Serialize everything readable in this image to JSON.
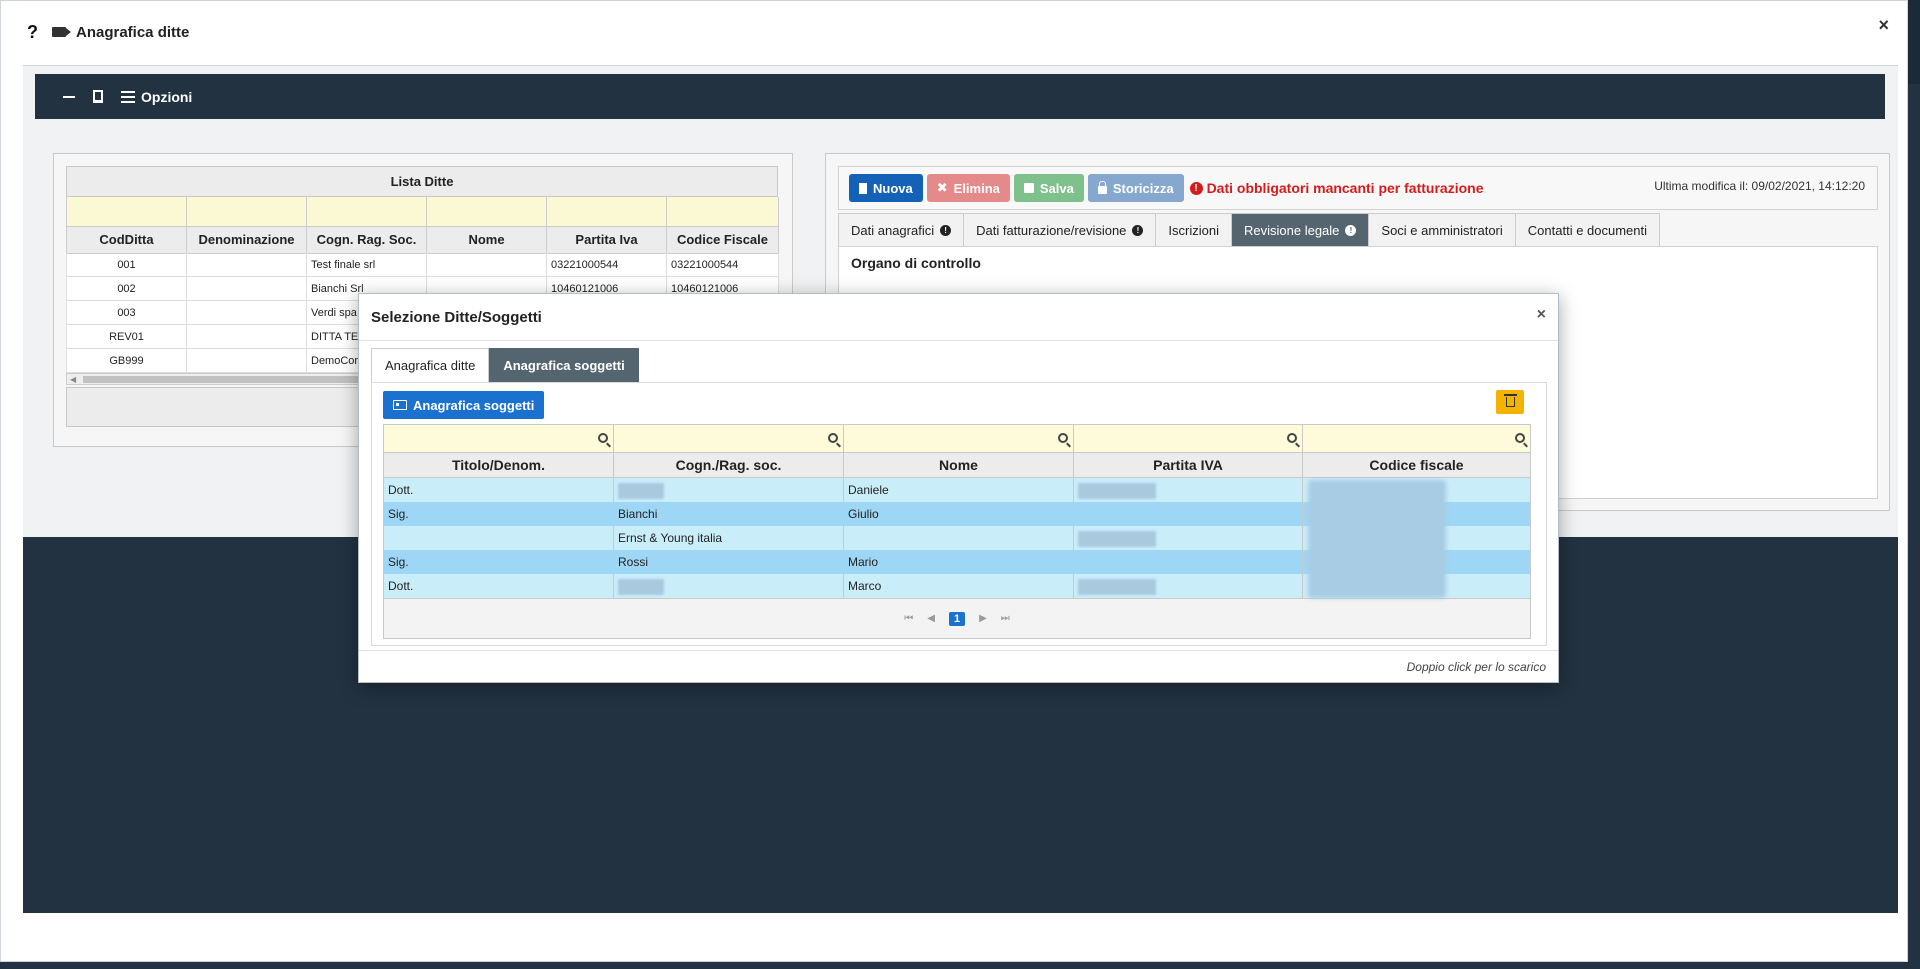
{
  "window": {
    "help_label": "?",
    "title": "Anagrafica ditte",
    "close_label": "×"
  },
  "toolbar": {
    "options_label": "Opzioni"
  },
  "lista_ditte": {
    "caption": "Lista Ditte",
    "columns": [
      "CodDitta",
      "Denominazione",
      "Cogn. Rag. Soc.",
      "Nome",
      "Partita Iva",
      "Codice Fiscale"
    ],
    "rows": [
      [
        "001",
        "",
        "Test finale srl",
        "",
        "03221000544",
        "03221000544"
      ],
      [
        "002",
        "",
        "Bianchi Srl",
        "",
        "10460121006",
        "10460121006"
      ],
      [
        "003",
        "",
        "Verdi spa",
        "",
        "",
        ""
      ],
      [
        "REV01",
        "",
        "DITTA TE",
        "",
        "",
        ""
      ],
      [
        "GB999",
        "",
        "DemoCor",
        "",
        "",
        ""
      ]
    ]
  },
  "editor": {
    "buttons": {
      "nuova": "Nuova",
      "elimina": "Elimina",
      "salva": "Salva",
      "storicizza": "Storicizza"
    },
    "warning": "Dati obbligatori mancanti per fatturazione",
    "last_modified": "Ultima modifica il: 09/02/2021, 14:12:20",
    "tabs": [
      "Dati anagrafici",
      "Dati fatturazione/revisione",
      "Iscrizioni",
      "Revisione legale",
      "Soci e amministratori",
      "Contatti e documenti"
    ],
    "section_title": "Organo di controllo"
  },
  "dialog": {
    "title": "Selezione Ditte/Soggetti",
    "close_label": "×",
    "tabs": [
      "Anagrafica ditte",
      "Anagrafica soggetti"
    ],
    "anagrafica_button": "Anagrafica soggetti",
    "columns": [
      "Titolo/Denom.",
      "Cogn./Rag. soc.",
      "Nome",
      "Partita IVA",
      "Codice fiscale"
    ],
    "rows": [
      {
        "titolo": "Dott.",
        "cognome": "",
        "nome": "Daniele",
        "piva": ""
      },
      {
        "titolo": "Sig.",
        "cognome": "Bianchi",
        "nome": "Giulio",
        "piva": ""
      },
      {
        "titolo": "",
        "cognome": "Ernst & Young italia",
        "nome": "",
        "piva": ""
      },
      {
        "titolo": "Sig.",
        "cognome": "Rossi",
        "nome": "Mario",
        "piva": ""
      },
      {
        "titolo": "Dott.",
        "cognome": "",
        "nome": "Marco",
        "piva": ""
      }
    ],
    "pager": {
      "current": "1",
      "first": "⏮",
      "prev": "◀",
      "next": "▶",
      "last": "⏭"
    },
    "footer_hint": "Doppio click per lo scarico"
  },
  "colors": {
    "accent": "#1a71cf",
    "dark": "#233240",
    "warning": "#d41c1c",
    "tab_active": "#546570"
  }
}
